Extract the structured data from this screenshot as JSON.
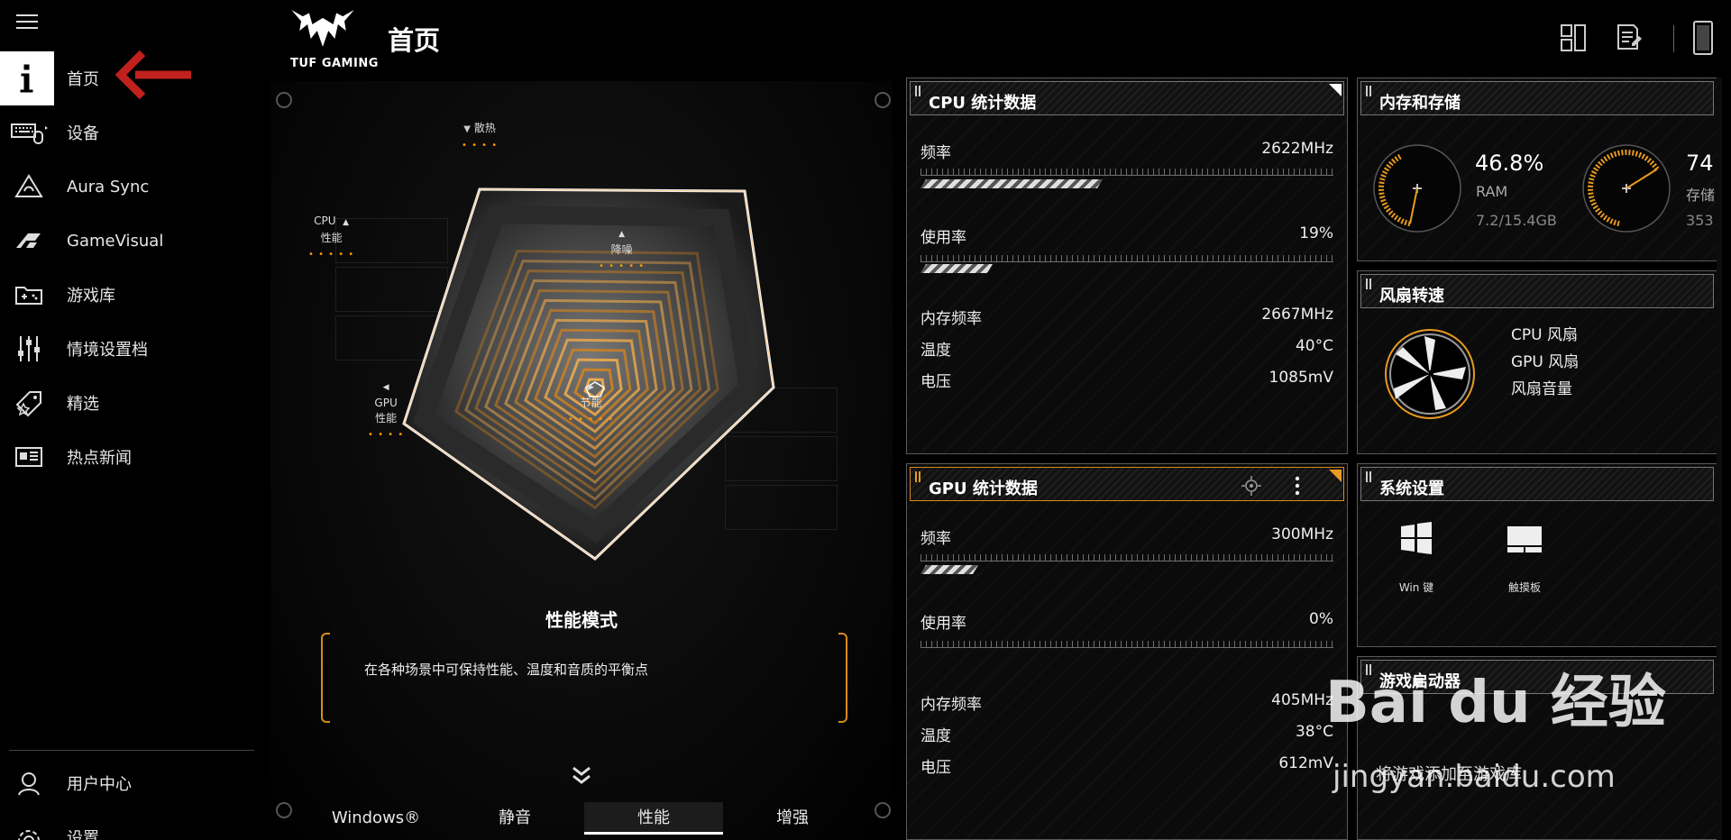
{
  "app": {
    "title": "首页",
    "logo_text": "TUF GAMING"
  },
  "sidebar": {
    "items": [
      {
        "label": "首页",
        "icon": "home-info-icon"
      },
      {
        "label": "设备",
        "icon": "keyboard-mouse-icon"
      },
      {
        "label": "Aura Sync",
        "icon": "aura-sync-icon"
      },
      {
        "label": "GameVisual",
        "icon": "gamevisual-icon"
      },
      {
        "label": "游戏库",
        "icon": "game-library-icon"
      },
      {
        "label": "情境设置档",
        "icon": "sliders-icon"
      },
      {
        "label": "精选",
        "icon": "tag-icon"
      },
      {
        "label": "热点新闻",
        "icon": "news-icon"
      }
    ],
    "bottom": [
      {
        "label": "用户中心",
        "icon": "user-icon"
      },
      {
        "label": "设置",
        "icon": "gear-icon"
      }
    ]
  },
  "center": {
    "axes": {
      "top": "散热",
      "left_l1": "CPU",
      "left_l2": "性能",
      "right": "降噪",
      "bottom_left_l1": "GPU",
      "bottom_left_l2": "性能",
      "bottom_right": "节能"
    },
    "mode_title": "性能模式",
    "mode_desc": "在各种场景中可保持性能、温度和音质的平衡点",
    "tabs": [
      {
        "label": "Windows®",
        "active": false
      },
      {
        "label": "静音",
        "active": false
      },
      {
        "label": "性能",
        "active": true
      },
      {
        "label": "增强",
        "active": false
      }
    ]
  },
  "cpu": {
    "title": "CPU 统计数据",
    "freq_label": "频率",
    "freq": "2622MHz",
    "freq_level": 0.44,
    "usage_label": "使用率",
    "usage": "19%",
    "usage_level": 0.19,
    "mem_freq_label": "内存频率",
    "mem_freq": "2667MHz",
    "temp_label": "温度",
    "temp": "40°C",
    "volt_label": "电压",
    "volt": "1085mV"
  },
  "gpu": {
    "title": "GPU 统计数据",
    "freq_label": "频率",
    "freq": "300MHz",
    "freq_level": 0.14,
    "usage_label": "使用率",
    "usage": "0%",
    "usage_level": 0,
    "mem_freq_label": "内存频率",
    "mem_freq": "405MHz",
    "temp_label": "温度",
    "temp": "38°C",
    "volt_label": "电压",
    "volt": "612mV"
  },
  "memory": {
    "title": "内存和存储",
    "ram_percent": "46.8%",
    "ram_label": "RAM",
    "ram_detail": "7.2/15.4GB",
    "ram_level": 0.468,
    "storage_percent": "74",
    "storage_label": "存储",
    "storage_detail": "353",
    "storage_level": 0.74
  },
  "fan": {
    "title": "风扇转速",
    "labels": [
      "CPU 风扇",
      "GPU 风扇",
      "风扇音量"
    ]
  },
  "system": {
    "title": "系统设置",
    "items": [
      {
        "label": "Win 键",
        "icon": "windows-key-icon"
      },
      {
        "label": "触摸板",
        "icon": "touchpad-icon"
      }
    ]
  },
  "launcher": {
    "title": "游戏启动器",
    "hint": "将游戏添加至游戏库"
  },
  "watermark": {
    "line1": "Bai du 经验",
    "line2": "jingyan.baidu.com"
  },
  "colors": {
    "accent": "#e89a20",
    "background": "#000000",
    "panel_border": "#5a5a5a"
  }
}
